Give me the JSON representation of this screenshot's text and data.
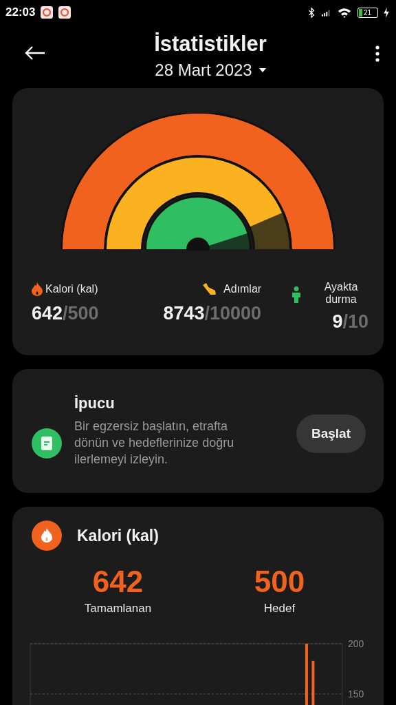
{
  "status_bar": {
    "time": "22:03",
    "battery": "21"
  },
  "header": {
    "title": "İstatistikler",
    "date": "28 Mart 2023"
  },
  "gauge": {
    "rings": [
      {
        "color": "#f0621e"
      },
      {
        "color": "#fbb220"
      },
      {
        "color": "#2fbf62"
      }
    ],
    "stats": [
      {
        "kind": "flame",
        "label": "Kalori (kal)",
        "value": "642",
        "goal": "/500"
      },
      {
        "kind": "shoe",
        "label": "Adımlar",
        "value": "8743",
        "goal": "/10000"
      },
      {
        "kind": "person",
        "label": "Ayakta durma",
        "value": "9",
        "goal": "/10"
      }
    ]
  },
  "tip": {
    "title": "İpucu",
    "text": "Bir egzersiz başlatın, etrafta dönün ve hedeflerinize doğru ilerlemeyi izleyin.",
    "button": "Başlat"
  },
  "calories": {
    "title": "Kalori (kal)",
    "completed": {
      "value": "642",
      "label": "Tamamlanan"
    },
    "goal": {
      "value": "500",
      "label": "Hedef"
    },
    "chart_data": {
      "type": "bar",
      "yticks": [
        150,
        200
      ],
      "ylim": [
        139,
        200
      ],
      "series": [
        {
          "color": "#f0621e",
          "values": [
            null,
            null,
            null,
            null,
            null,
            null,
            null,
            null,
            null,
            null,
            null,
            null,
            null,
            null,
            null,
            null,
            null,
            null,
            null,
            null,
            null,
            null,
            null,
            null,
            null,
            null,
            null,
            null,
            null,
            null,
            null,
            null,
            null,
            null,
            null,
            null,
            null,
            null,
            null,
            null,
            null,
            null,
            200,
            183,
            null,
            null,
            null,
            null
          ]
        }
      ]
    }
  }
}
